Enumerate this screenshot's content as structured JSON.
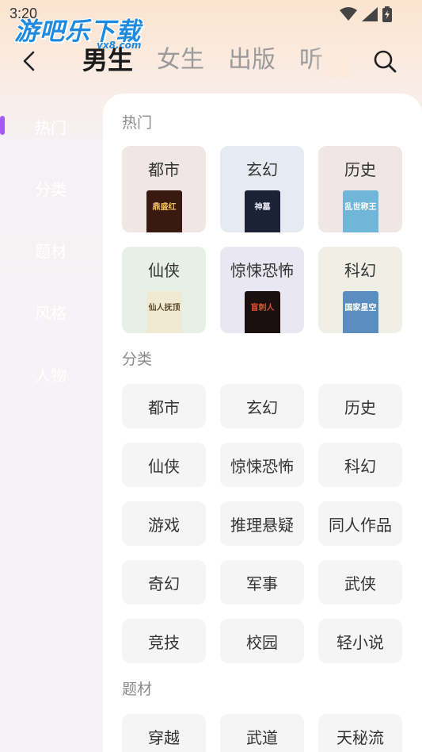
{
  "status_bar": {
    "time": "3:20"
  },
  "watermark": {
    "text": "游吧乐下载",
    "sub": "yx8.com"
  },
  "nav": {
    "tabs": [
      {
        "label": "男生",
        "active": true
      },
      {
        "label": "女生",
        "active": false
      },
      {
        "label": "出版",
        "active": false
      },
      {
        "label": "听",
        "active": false
      }
    ]
  },
  "sidebar": {
    "items": [
      {
        "label": "热门",
        "active": true
      },
      {
        "label": "分类",
        "active": false
      },
      {
        "label": "题材",
        "active": false
      },
      {
        "label": "风格",
        "active": false
      },
      {
        "label": "人物",
        "active": false
      }
    ]
  },
  "hot": {
    "title": "热门",
    "cards": [
      {
        "label": "都市",
        "bg": "#f1e6e6",
        "cover_bg": "#3a1a10",
        "cover_text": "鼎盛红",
        "cover_color": "#f0c060"
      },
      {
        "label": "玄幻",
        "bg": "#e6eaf2",
        "cover_bg": "#1c2236",
        "cover_text": "神墓",
        "cover_color": "#e8e8f0"
      },
      {
        "label": "历史",
        "bg": "#f1e6e6",
        "cover_bg": "#6fb6d8",
        "cover_text": "乱世称王",
        "cover_color": "#ffffff"
      },
      {
        "label": "仙侠",
        "bg": "#e6f0e6",
        "cover_bg": "#f1ead2",
        "cover_text": "仙人抚顶",
        "cover_color": "#5a4a2a"
      },
      {
        "label": "惊悚恐怖",
        "bg": "#e9e8f2",
        "cover_bg": "#1a1010",
        "cover_text": "盲刺人",
        "cover_color": "#e05030"
      },
      {
        "label": "科幻",
        "bg": "#efefe6",
        "cover_bg": "#5a8ec0",
        "cover_text": "国家星空",
        "cover_color": "#ffffff"
      }
    ]
  },
  "category": {
    "title": "分类",
    "chips": [
      "都市",
      "玄幻",
      "历史",
      "仙侠",
      "惊悚恐怖",
      "科幻",
      "游戏",
      "推理悬疑",
      "同人作品",
      "奇幻",
      "军事",
      "武侠",
      "竞技",
      "校园",
      "轻小说"
    ]
  },
  "theme": {
    "title": "题材",
    "chips": [
      "穿越",
      "武道",
      "天秘流"
    ]
  }
}
